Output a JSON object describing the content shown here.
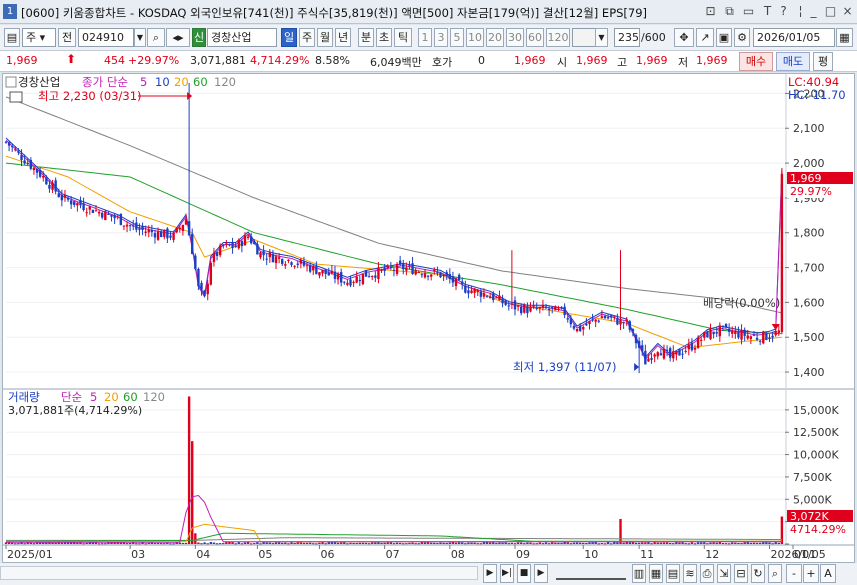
{
  "window": {
    "title": "[0600] 키움종합차트 - KOSDAQ 외국인보유[741(천)] 주식수[35,819(천)] 액면[500] 자본금[179(억)] 결산[12월] EPS[79]",
    "icon_label": "1"
  },
  "toolbar": {
    "market": "주",
    "prev": "전",
    "code": "024910",
    "sin": "신",
    "stock_name": "경창산업",
    "periods": [
      "일",
      "주",
      "월",
      "년",
      "분",
      "초",
      "틱"
    ],
    "intervals": [
      "1",
      "3",
      "5",
      "10",
      "20",
      "30",
      "60",
      "120"
    ],
    "count": "235",
    "count_total": "/600",
    "date": "2026/01/05"
  },
  "quote": {
    "price": "1,969",
    "change": "454",
    "change_pct": "+29.97%",
    "volume": "3,071,881",
    "volume_pct": "4,714.29%",
    "turnover": "8.58%",
    "amount": "6,049백만",
    "hoga_label": "호가",
    "hoga_value": "0",
    "hoga_price": "1,969",
    "open_label": "시",
    "open": "1,969",
    "high_label": "고",
    "high": "1,969",
    "low_label": "저",
    "low": "1,969",
    "buy_label": "매수",
    "sell_label": "매도",
    "eval_label": "평"
  },
  "price_panel": {
    "legend_name": "경창산업",
    "legend_ma": "종가 단순",
    "ma_periods": [
      "5",
      "10",
      "20",
      "60",
      "120"
    ],
    "lc": "LC:40.94",
    "hc": "HC:-11.70",
    "max_label": "최고 2,230 (03/31)",
    "min_label": "최저 1,397 (11/07)",
    "dividend_label": "배당락(0.00%)",
    "current_price_tag": "1,969",
    "current_pct_tag": "29.97%"
  },
  "volume_panel": {
    "legend_name": "거래량",
    "legend_ma": "단순",
    "ma_periods": [
      "5",
      "20",
      "60",
      "120"
    ],
    "current_volume": "3,071,881주(4,714.29%)",
    "current_vol_tag": "3,072K",
    "current_vol_pct_tag": "4714.29%"
  },
  "colors": {
    "up": "#e0001b",
    "down": "#1a3fc4",
    "ma5": "#c21fb8",
    "ma10": "#1a3fc4",
    "ma20": "#f0a000",
    "ma60": "#1fa02a",
    "ma120": "#808080"
  },
  "chart_data": [
    {
      "type": "candlestick",
      "title": "경창산업",
      "ylim": [
        1360,
        2250
      ],
      "yticks": [
        "2,200",
        "2,100",
        "2,000",
        "1,900",
        "1,800",
        "1,700",
        "1,600",
        "1,500",
        "1,400"
      ],
      "ytick_values": [
        2200,
        2100,
        2000,
        1900,
        1800,
        1700,
        1600,
        1500,
        1400
      ],
      "x_labels": [
        "2025/01",
        "03",
        "04",
        "05",
        "06",
        "07",
        "08",
        "09",
        "10",
        "11",
        "12",
        "2026/01",
        "01/05"
      ],
      "x_label_days": [
        0,
        40,
        61,
        81,
        101,
        122,
        143,
        164,
        186,
        204,
        225,
        246,
        251
      ],
      "close_path": [
        [
          0,
          2060
        ],
        [
          6,
          2010
        ],
        [
          12,
          1960
        ],
        [
          18,
          1900
        ],
        [
          24,
          1880
        ],
        [
          30,
          1860
        ],
        [
          36,
          1840
        ],
        [
          42,
          1810
        ],
        [
          48,
          1800
        ],
        [
          54,
          1790
        ],
        [
          58,
          1840
        ],
        [
          60,
          1750
        ],
        [
          62,
          1640
        ],
        [
          64,
          1610
        ],
        [
          66,
          1720
        ],
        [
          70,
          1760
        ],
        [
          74,
          1760
        ],
        [
          78,
          1790
        ],
        [
          82,
          1740
        ],
        [
          86,
          1730
        ],
        [
          92,
          1720
        ],
        [
          98,
          1700
        ],
        [
          104,
          1680
        ],
        [
          110,
          1660
        ],
        [
          116,
          1680
        ],
        [
          122,
          1690
        ],
        [
          128,
          1700
        ],
        [
          134,
          1690
        ],
        [
          140,
          1680
        ],
        [
          144,
          1660
        ],
        [
          148,
          1640
        ],
        [
          152,
          1630
        ],
        [
          156,
          1620
        ],
        [
          162,
          1590
        ],
        [
          168,
          1580
        ],
        [
          174,
          1580
        ],
        [
          180,
          1570
        ],
        [
          184,
          1520
        ],
        [
          188,
          1540
        ],
        [
          192,
          1560
        ],
        [
          196,
          1550
        ],
        [
          200,
          1540
        ],
        [
          204,
          1470
        ],
        [
          206,
          1430
        ],
        [
          210,
          1470
        ],
        [
          214,
          1440
        ],
        [
          218,
          1460
        ],
        [
          222,
          1480
        ],
        [
          226,
          1510
        ],
        [
          230,
          1520
        ],
        [
          236,
          1510
        ],
        [
          242,
          1500
        ],
        [
          246,
          1505
        ],
        [
          249,
          1515
        ],
        [
          250,
          1969
        ]
      ],
      "wick_spikes": [
        [
          59,
          2230
        ],
        [
          163,
          1750
        ],
        [
          198,
          1750
        ]
      ],
      "ma_120": [
        [
          0,
          2190
        ],
        [
          40,
          2050
        ],
        [
          80,
          1900
        ],
        [
          120,
          1770
        ],
        [
          160,
          1690
        ],
        [
          200,
          1640
        ],
        [
          230,
          1610
        ],
        [
          250,
          1570
        ]
      ],
      "ma_60": [
        [
          0,
          2000
        ],
        [
          40,
          1960
        ],
        [
          80,
          1800
        ],
        [
          120,
          1710
        ],
        [
          160,
          1650
        ],
        [
          200,
          1580
        ],
        [
          230,
          1520
        ],
        [
          250,
          1510
        ]
      ],
      "ma_20": [
        [
          0,
          2020
        ],
        [
          20,
          1960
        ],
        [
          40,
          1860
        ],
        [
          60,
          1800
        ],
        [
          64,
          1730
        ],
        [
          80,
          1780
        ],
        [
          100,
          1710
        ],
        [
          140,
          1680
        ],
        [
          160,
          1600
        ],
        [
          200,
          1540
        ],
        [
          220,
          1470
        ],
        [
          250,
          1500
        ]
      ]
    },
    {
      "type": "bar",
      "title": "거래량",
      "ylim": [
        0,
        17000
      ],
      "yticks": [
        "15,000K",
        "12,500K",
        "10,000K",
        "7,500K",
        "5,000K",
        "2,500K",
        "0"
      ],
      "ytick_values": [
        15000,
        12500,
        10000,
        7500,
        5000,
        2500,
        0
      ],
      "unit": "K",
      "spikes": [
        [
          59,
          16500
        ],
        [
          60,
          11500
        ],
        [
          61,
          1200
        ],
        [
          198,
          2800
        ],
        [
          250,
          3072
        ]
      ],
      "baseline_volume": 150
    }
  ],
  "bottom": {
    "zoom_minus": "-",
    "zoom_plus": "+",
    "font_a": "A"
  }
}
